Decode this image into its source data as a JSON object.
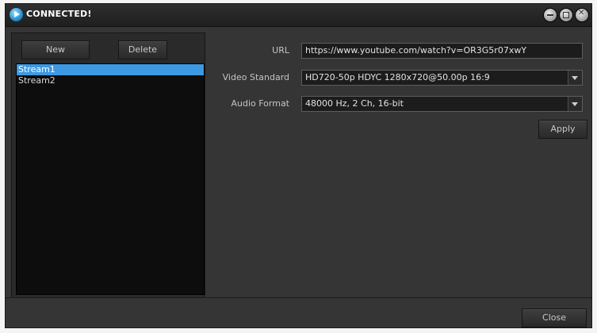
{
  "window": {
    "title": "CONNECTED!"
  },
  "streams": {
    "new_label": "New",
    "delete_label": "Delete",
    "items": [
      {
        "label": "Stream1",
        "selected": true
      },
      {
        "label": "Stream2",
        "selected": false
      }
    ]
  },
  "settings": {
    "url_label": "URL",
    "url_value": "https://www.youtube.com/watch?v=OR3G5r07xwY",
    "video_standard_label": "Video Standard",
    "video_standard_value": "HD720-50p HDYC 1280x720@50.00p 16:9",
    "audio_format_label": "Audio Format",
    "audio_format_value": "48000 Hz, 2 Ch, 16-bit",
    "apply_label": "Apply"
  },
  "footer": {
    "close_label": "Close"
  },
  "colors": {
    "selection": "#3d99e2",
    "window_bg": "#353535",
    "list_bg": "#0d0d0d"
  },
  "icons": {
    "app": "play-circle-icon",
    "minimize": "minimize-icon",
    "maximize": "maximize-icon",
    "close": "close-icon",
    "dropdown": "chevron-down-icon"
  }
}
